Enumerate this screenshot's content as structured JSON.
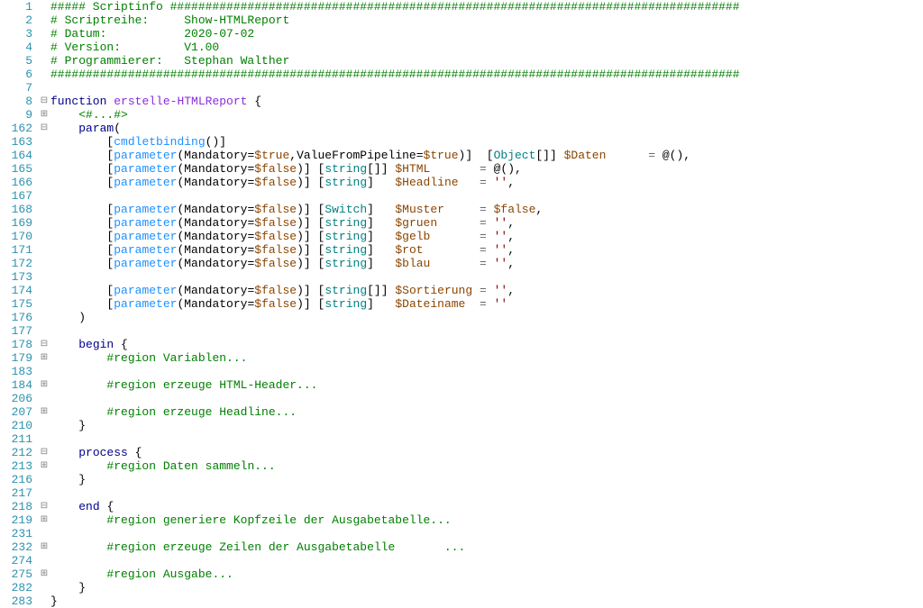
{
  "lines": [
    {
      "n": "1",
      "f": "",
      "segs": [
        {
          "c": "c-comment",
          "t": "##### Scriptinfo #################################################################################"
        }
      ]
    },
    {
      "n": "2",
      "f": "",
      "segs": [
        {
          "c": "c-comment",
          "t": "# Scriptreihe:     Show-HTMLReport"
        }
      ]
    },
    {
      "n": "3",
      "f": "",
      "segs": [
        {
          "c": "c-comment",
          "t": "# Datum:           2020-07-02"
        }
      ]
    },
    {
      "n": "4",
      "f": "",
      "segs": [
        {
          "c": "c-comment",
          "t": "# Version:         V1.00"
        }
      ]
    },
    {
      "n": "5",
      "f": "",
      "segs": [
        {
          "c": "c-comment",
          "t": "# Programmierer:   Stephan Walther"
        }
      ]
    },
    {
      "n": "6",
      "f": "",
      "segs": [
        {
          "c": "c-comment",
          "t": "##################################################################################################"
        }
      ]
    },
    {
      "n": "7",
      "f": "",
      "segs": [
        {
          "c": "",
          "t": ""
        }
      ]
    },
    {
      "n": "8",
      "f": "⊟",
      "segs": [
        {
          "c": "c-key",
          "t": "function"
        },
        {
          "c": "",
          "t": " "
        },
        {
          "c": "c-func",
          "t": "erstelle-HTMLReport"
        },
        {
          "c": "",
          "t": " "
        },
        {
          "c": "c-punc",
          "t": "{"
        }
      ]
    },
    {
      "n": "9",
      "f": "⊞",
      "segs": [
        {
          "c": "",
          "t": "    "
        },
        {
          "c": "c-comment",
          "t": "<#...#>"
        }
      ]
    },
    {
      "n": "162",
      "f": "⊟",
      "segs": [
        {
          "c": "",
          "t": "    "
        },
        {
          "c": "c-key",
          "t": "param"
        },
        {
          "c": "c-punc",
          "t": "("
        }
      ]
    },
    {
      "n": "163",
      "f": "",
      "segs": [
        {
          "c": "",
          "t": "        "
        },
        {
          "c": "c-punc",
          "t": "["
        },
        {
          "c": "c-attr",
          "t": "cmdletbinding"
        },
        {
          "c": "c-punc",
          "t": "()]"
        }
      ]
    },
    {
      "n": "164",
      "f": "",
      "segs": [
        {
          "c": "",
          "t": "        "
        },
        {
          "c": "c-punc",
          "t": "["
        },
        {
          "c": "c-attr",
          "t": "parameter"
        },
        {
          "c": "c-punc",
          "t": "(Mandatory="
        },
        {
          "c": "c-var",
          "t": "$true"
        },
        {
          "c": "c-punc",
          "t": ",ValueFromPipeline="
        },
        {
          "c": "c-var",
          "t": "$true"
        },
        {
          "c": "c-punc",
          "t": ")]  ["
        },
        {
          "c": "c-type",
          "t": "Object"
        },
        {
          "c": "c-punc",
          "t": "[]] "
        },
        {
          "c": "c-var",
          "t": "$Daten"
        },
        {
          "c": "",
          "t": "      "
        },
        {
          "c": "c-op",
          "t": "="
        },
        {
          "c": "",
          "t": " @"
        },
        {
          "c": "c-punc",
          "t": "(),"
        }
      ]
    },
    {
      "n": "165",
      "f": "",
      "segs": [
        {
          "c": "",
          "t": "        "
        },
        {
          "c": "c-punc",
          "t": "["
        },
        {
          "c": "c-attr",
          "t": "parameter"
        },
        {
          "c": "c-punc",
          "t": "(Mandatory="
        },
        {
          "c": "c-var",
          "t": "$false"
        },
        {
          "c": "c-punc",
          "t": ")] ["
        },
        {
          "c": "c-type",
          "t": "string"
        },
        {
          "c": "c-punc",
          "t": "[]] "
        },
        {
          "c": "c-var",
          "t": "$HTML"
        },
        {
          "c": "",
          "t": "       "
        },
        {
          "c": "c-op",
          "t": "="
        },
        {
          "c": "",
          "t": " @"
        },
        {
          "c": "c-punc",
          "t": "(),"
        }
      ]
    },
    {
      "n": "166",
      "f": "",
      "segs": [
        {
          "c": "",
          "t": "        "
        },
        {
          "c": "c-punc",
          "t": "["
        },
        {
          "c": "c-attr",
          "t": "parameter"
        },
        {
          "c": "c-punc",
          "t": "(Mandatory="
        },
        {
          "c": "c-var",
          "t": "$false"
        },
        {
          "c": "c-punc",
          "t": ")] ["
        },
        {
          "c": "c-type",
          "t": "string"
        },
        {
          "c": "c-punc",
          "t": "]   "
        },
        {
          "c": "c-var",
          "t": "$Headline"
        },
        {
          "c": "",
          "t": "   "
        },
        {
          "c": "c-op",
          "t": "="
        },
        {
          "c": "",
          "t": " "
        },
        {
          "c": "c-str",
          "t": "''"
        },
        {
          "c": "c-punc",
          "t": ","
        }
      ]
    },
    {
      "n": "167",
      "f": "",
      "segs": [
        {
          "c": "",
          "t": ""
        }
      ]
    },
    {
      "n": "168",
      "f": "",
      "segs": [
        {
          "c": "",
          "t": "        "
        },
        {
          "c": "c-punc",
          "t": "["
        },
        {
          "c": "c-attr",
          "t": "parameter"
        },
        {
          "c": "c-punc",
          "t": "(Mandatory="
        },
        {
          "c": "c-var",
          "t": "$false"
        },
        {
          "c": "c-punc",
          "t": ")] ["
        },
        {
          "c": "c-type",
          "t": "Switch"
        },
        {
          "c": "c-punc",
          "t": "]   "
        },
        {
          "c": "c-var",
          "t": "$Muster"
        },
        {
          "c": "",
          "t": "     "
        },
        {
          "c": "c-op",
          "t": "="
        },
        {
          "c": "",
          "t": " "
        },
        {
          "c": "c-var",
          "t": "$false"
        },
        {
          "c": "c-punc",
          "t": ","
        }
      ]
    },
    {
      "n": "169",
      "f": "",
      "segs": [
        {
          "c": "",
          "t": "        "
        },
        {
          "c": "c-punc",
          "t": "["
        },
        {
          "c": "c-attr",
          "t": "parameter"
        },
        {
          "c": "c-punc",
          "t": "(Mandatory="
        },
        {
          "c": "c-var",
          "t": "$false"
        },
        {
          "c": "c-punc",
          "t": ")] ["
        },
        {
          "c": "c-type",
          "t": "string"
        },
        {
          "c": "c-punc",
          "t": "]   "
        },
        {
          "c": "c-var",
          "t": "$gruen"
        },
        {
          "c": "",
          "t": "      "
        },
        {
          "c": "c-op",
          "t": "="
        },
        {
          "c": "",
          "t": " "
        },
        {
          "c": "c-str",
          "t": "''"
        },
        {
          "c": "c-punc",
          "t": ","
        }
      ]
    },
    {
      "n": "170",
      "f": "",
      "segs": [
        {
          "c": "",
          "t": "        "
        },
        {
          "c": "c-punc",
          "t": "["
        },
        {
          "c": "c-attr",
          "t": "parameter"
        },
        {
          "c": "c-punc",
          "t": "(Mandatory="
        },
        {
          "c": "c-var",
          "t": "$false"
        },
        {
          "c": "c-punc",
          "t": ")] ["
        },
        {
          "c": "c-type",
          "t": "string"
        },
        {
          "c": "c-punc",
          "t": "]   "
        },
        {
          "c": "c-var",
          "t": "$gelb"
        },
        {
          "c": "",
          "t": "       "
        },
        {
          "c": "c-op",
          "t": "="
        },
        {
          "c": "",
          "t": " "
        },
        {
          "c": "c-str",
          "t": "''"
        },
        {
          "c": "c-punc",
          "t": ","
        }
      ]
    },
    {
      "n": "171",
      "f": "",
      "segs": [
        {
          "c": "",
          "t": "        "
        },
        {
          "c": "c-punc",
          "t": "["
        },
        {
          "c": "c-attr",
          "t": "parameter"
        },
        {
          "c": "c-punc",
          "t": "(Mandatory="
        },
        {
          "c": "c-var",
          "t": "$false"
        },
        {
          "c": "c-punc",
          "t": ")] ["
        },
        {
          "c": "c-type",
          "t": "string"
        },
        {
          "c": "c-punc",
          "t": "]   "
        },
        {
          "c": "c-var",
          "t": "$rot"
        },
        {
          "c": "",
          "t": "        "
        },
        {
          "c": "c-op",
          "t": "="
        },
        {
          "c": "",
          "t": " "
        },
        {
          "c": "c-str",
          "t": "''"
        },
        {
          "c": "c-punc",
          "t": ","
        }
      ]
    },
    {
      "n": "172",
      "f": "",
      "segs": [
        {
          "c": "",
          "t": "        "
        },
        {
          "c": "c-punc",
          "t": "["
        },
        {
          "c": "c-attr",
          "t": "parameter"
        },
        {
          "c": "c-punc",
          "t": "(Mandatory="
        },
        {
          "c": "c-var",
          "t": "$false"
        },
        {
          "c": "c-punc",
          "t": ")] ["
        },
        {
          "c": "c-type",
          "t": "string"
        },
        {
          "c": "c-punc",
          "t": "]   "
        },
        {
          "c": "c-var",
          "t": "$blau"
        },
        {
          "c": "",
          "t": "       "
        },
        {
          "c": "c-op",
          "t": "="
        },
        {
          "c": "",
          "t": " "
        },
        {
          "c": "c-str",
          "t": "''"
        },
        {
          "c": "c-punc",
          "t": ","
        }
      ]
    },
    {
      "n": "173",
      "f": "",
      "segs": [
        {
          "c": "",
          "t": ""
        }
      ]
    },
    {
      "n": "174",
      "f": "",
      "segs": [
        {
          "c": "",
          "t": "        "
        },
        {
          "c": "c-punc",
          "t": "["
        },
        {
          "c": "c-attr",
          "t": "parameter"
        },
        {
          "c": "c-punc",
          "t": "(Mandatory="
        },
        {
          "c": "c-var",
          "t": "$false"
        },
        {
          "c": "c-punc",
          "t": ")] ["
        },
        {
          "c": "c-type",
          "t": "string"
        },
        {
          "c": "c-punc",
          "t": "[]] "
        },
        {
          "c": "c-var",
          "t": "$Sortierung"
        },
        {
          "c": "",
          "t": " "
        },
        {
          "c": "c-op",
          "t": "="
        },
        {
          "c": "",
          "t": " "
        },
        {
          "c": "c-str",
          "t": "''"
        },
        {
          "c": "c-punc",
          "t": ","
        }
      ]
    },
    {
      "n": "175",
      "f": "",
      "segs": [
        {
          "c": "",
          "t": "        "
        },
        {
          "c": "c-punc",
          "t": "["
        },
        {
          "c": "c-attr",
          "t": "parameter"
        },
        {
          "c": "c-punc",
          "t": "(Mandatory="
        },
        {
          "c": "c-var",
          "t": "$false"
        },
        {
          "c": "c-punc",
          "t": ")] ["
        },
        {
          "c": "c-type",
          "t": "string"
        },
        {
          "c": "c-punc",
          "t": "]   "
        },
        {
          "c": "c-var",
          "t": "$Dateiname"
        },
        {
          "c": "",
          "t": "  "
        },
        {
          "c": "c-op",
          "t": "="
        },
        {
          "c": "",
          "t": " "
        },
        {
          "c": "c-str",
          "t": "''"
        }
      ]
    },
    {
      "n": "176",
      "f": "",
      "segs": [
        {
          "c": "",
          "t": "    "
        },
        {
          "c": "c-punc",
          "t": ")"
        }
      ]
    },
    {
      "n": "177",
      "f": "",
      "segs": [
        {
          "c": "",
          "t": ""
        }
      ]
    },
    {
      "n": "178",
      "f": "⊟",
      "segs": [
        {
          "c": "",
          "t": "    "
        },
        {
          "c": "c-key",
          "t": "begin"
        },
        {
          "c": "",
          "t": " "
        },
        {
          "c": "c-punc",
          "t": "{"
        }
      ]
    },
    {
      "n": "179",
      "f": "⊞",
      "segs": [
        {
          "c": "",
          "t": "        "
        },
        {
          "c": "c-comment",
          "t": "#region Variablen..."
        }
      ]
    },
    {
      "n": "183",
      "f": "",
      "segs": [
        {
          "c": "",
          "t": ""
        }
      ]
    },
    {
      "n": "184",
      "f": "⊞",
      "segs": [
        {
          "c": "",
          "t": "        "
        },
        {
          "c": "c-comment",
          "t": "#region erzeuge HTML-Header..."
        }
      ]
    },
    {
      "n": "206",
      "f": "",
      "segs": [
        {
          "c": "",
          "t": ""
        }
      ]
    },
    {
      "n": "207",
      "f": "⊞",
      "segs": [
        {
          "c": "",
          "t": "        "
        },
        {
          "c": "c-comment",
          "t": "#region erzeuge Headline..."
        }
      ]
    },
    {
      "n": "210",
      "f": "",
      "segs": [
        {
          "c": "",
          "t": "    "
        },
        {
          "c": "c-punc",
          "t": "}"
        }
      ]
    },
    {
      "n": "211",
      "f": "",
      "segs": [
        {
          "c": "",
          "t": ""
        }
      ]
    },
    {
      "n": "212",
      "f": "⊟",
      "segs": [
        {
          "c": "",
          "t": "    "
        },
        {
          "c": "c-key",
          "t": "process"
        },
        {
          "c": "",
          "t": " "
        },
        {
          "c": "c-punc",
          "t": "{"
        }
      ]
    },
    {
      "n": "213",
      "f": "⊞",
      "segs": [
        {
          "c": "",
          "t": "        "
        },
        {
          "c": "c-comment",
          "t": "#region Daten sammeln..."
        }
      ]
    },
    {
      "n": "216",
      "f": "",
      "segs": [
        {
          "c": "",
          "t": "    "
        },
        {
          "c": "c-punc",
          "t": "}"
        }
      ]
    },
    {
      "n": "217",
      "f": "",
      "segs": [
        {
          "c": "",
          "t": ""
        }
      ]
    },
    {
      "n": "218",
      "f": "⊟",
      "segs": [
        {
          "c": "",
          "t": "    "
        },
        {
          "c": "c-key",
          "t": "end"
        },
        {
          "c": "",
          "t": " "
        },
        {
          "c": "c-punc",
          "t": "{"
        }
      ]
    },
    {
      "n": "219",
      "f": "⊞",
      "segs": [
        {
          "c": "",
          "t": "        "
        },
        {
          "c": "c-comment",
          "t": "#region generiere Kopfzeile der Ausgabetabelle..."
        }
      ]
    },
    {
      "n": "231",
      "f": "",
      "segs": [
        {
          "c": "",
          "t": ""
        }
      ]
    },
    {
      "n": "232",
      "f": "⊞",
      "segs": [
        {
          "c": "",
          "t": "        "
        },
        {
          "c": "c-comment",
          "t": "#region erzeuge Zeilen der Ausgabetabelle       ..."
        }
      ]
    },
    {
      "n": "274",
      "f": "",
      "segs": [
        {
          "c": "",
          "t": ""
        }
      ]
    },
    {
      "n": "275",
      "f": "⊞",
      "segs": [
        {
          "c": "",
          "t": "        "
        },
        {
          "c": "c-comment",
          "t": "#region Ausgabe..."
        }
      ]
    },
    {
      "n": "282",
      "f": "",
      "segs": [
        {
          "c": "",
          "t": "    "
        },
        {
          "c": "c-punc",
          "t": "}"
        }
      ]
    },
    {
      "n": "283",
      "f": "",
      "segs": [
        {
          "c": "c-punc",
          "t": "}"
        }
      ]
    }
  ]
}
